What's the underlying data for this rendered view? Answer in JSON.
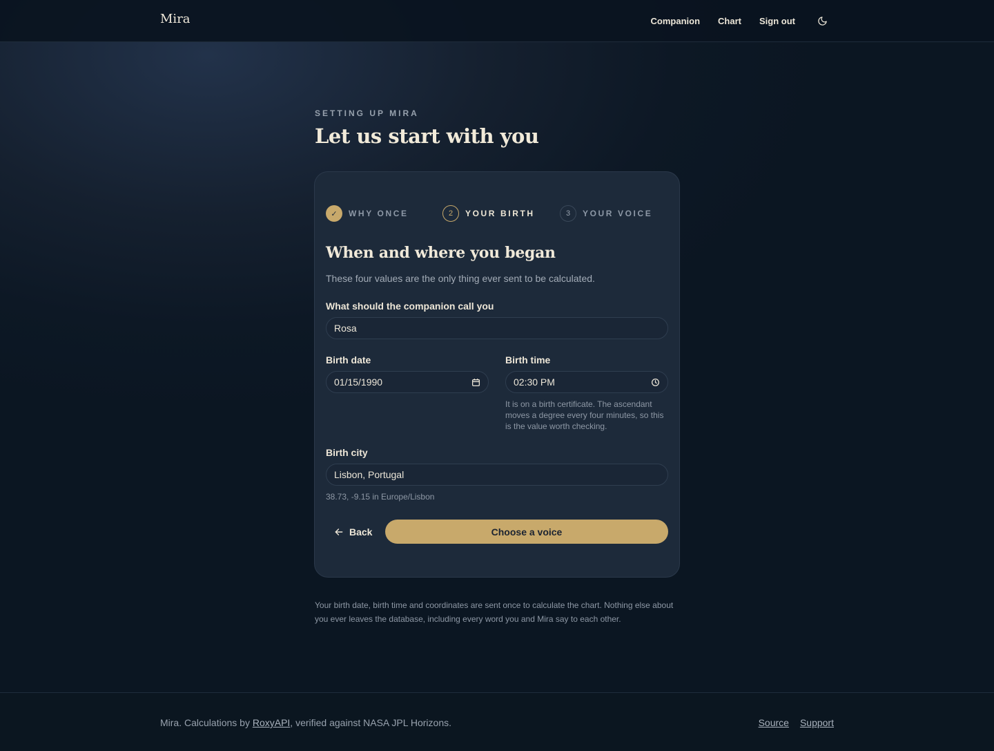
{
  "header": {
    "brand": "Mira",
    "nav": [
      "Companion",
      "Chart",
      "Sign out"
    ],
    "theme_icon": "moon-icon"
  },
  "intro": {
    "eyebrow": "SETTING UP MIRA",
    "title": "Let us start with you"
  },
  "steps": [
    {
      "marker": "✓",
      "label": "WHY ONCE",
      "state": "done"
    },
    {
      "marker": "2",
      "label": "YOUR BIRTH",
      "state": "active"
    },
    {
      "marker": "3",
      "label": "YOUR VOICE",
      "state": "todo"
    }
  ],
  "form": {
    "title": "When and where you began",
    "subtitle": "These four values are the only thing ever sent to be calculated.",
    "name_label": "What should the companion call you",
    "name_value": "Rosa",
    "date_label": "Birth date",
    "date_value": "01/15/1990",
    "time_label": "Birth time",
    "time_value": "02:30 PM",
    "time_hint": "It is on a birth certificate. The ascendant moves a degree every four minutes, so this is the value worth checking.",
    "city_label": "Birth city",
    "city_value": "Lisbon, Portugal",
    "city_hint": "38.73, -9.15 in Europe/Lisbon",
    "back_label": "Back",
    "next_label": "Choose a voice"
  },
  "privacy_note": "Your birth date, birth time and coordinates are sent once to calculate the chart. Nothing else about you ever leaves the database, including every word you and Mira say to each other.",
  "footer": {
    "prefix": "Mira. Calculations by ",
    "link": "RoxyAPI",
    "suffix": ", verified against NASA JPL Horizons.",
    "links": [
      "Source",
      "Support"
    ]
  },
  "colors": {
    "accent": "#c8a96b",
    "card": "#1d2a3a",
    "background": "#0c1723"
  }
}
